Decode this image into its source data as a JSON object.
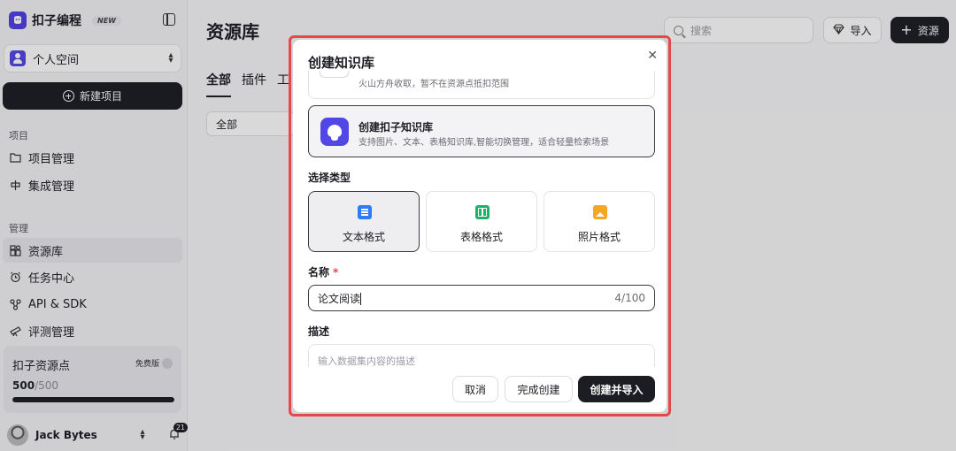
{
  "brand": {
    "name": "扣子编程",
    "badge": "NEW",
    "color": "#4e40e5"
  },
  "workspace": {
    "label": "个人空间"
  },
  "sidebar": {
    "new_project": "新建项目",
    "section_project": "项目",
    "section_manage": "管理",
    "items": [
      {
        "label": "项目管理",
        "icon": "folder-icon"
      },
      {
        "label": "集成管理",
        "icon": "integration-icon"
      },
      {
        "label": "资源库",
        "icon": "library-icon",
        "active": true
      },
      {
        "label": "任务中心",
        "icon": "alarm-clock-icon"
      },
      {
        "label": "API & SDK",
        "icon": "api-icon"
      },
      {
        "label": "评测管理",
        "icon": "telescope-icon"
      }
    ],
    "points": {
      "title": "扣子资源点",
      "plan": "免费版",
      "used": "500",
      "total": "/500",
      "fill_ratio": 1.0
    },
    "user": {
      "name": "Jack Bytes",
      "notifications": "21"
    }
  },
  "main": {
    "title": "资源库",
    "tabs": [
      "全部",
      "插件",
      "工"
    ],
    "filter": "全部",
    "search_placeholder": "搜索",
    "import_label": "导入",
    "resource_label": "资源"
  },
  "modal": {
    "title": "创建知识库",
    "prev_option_desc": "火山方舟收取，暂不在资源点抵扣范围",
    "kb_option": {
      "title": "创建扣子知识库",
      "desc": "支持图片、文本、表格知识库,智能切换管理，适合轻量检索场景"
    },
    "type_label": "选择类型",
    "types": [
      {
        "label": "文本格式",
        "icon": "document-icon",
        "selected": true
      },
      {
        "label": "表格格式",
        "icon": "table-icon",
        "selected": false
      },
      {
        "label": "照片格式",
        "icon": "image-icon",
        "selected": false
      }
    ],
    "name_label": "名称",
    "required_mark": "*",
    "name_value": "论文阅读",
    "name_count": "4/100",
    "desc_label": "描述",
    "desc_placeholder": "输入数据集内容的描述",
    "buttons": {
      "cancel": "取消",
      "create": "完成创建",
      "create_import": "创建并导入"
    }
  },
  "colors": {
    "highlight_border": "#e5474a",
    "primary": "#1c1d23"
  }
}
